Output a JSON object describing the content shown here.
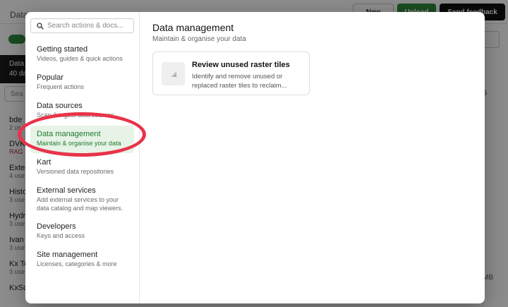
{
  "background": {
    "title": "Data",
    "new_button": "New",
    "upload_button": "Upload",
    "feedback_button": "Send feedback",
    "active_item": {
      "name": "Data",
      "count": "40 da"
    },
    "search": "Sea",
    "list": [
      {
        "name": "bde",
        "sub": "2 us"
      },
      {
        "name": "DVK",
        "sub": "RAG"
      },
      {
        "name": "Exter",
        "sub": "4 use"
      },
      {
        "name": "Histo",
        "sub": "3 use"
      },
      {
        "name": "Hydr",
        "sub": "3 use"
      },
      {
        "name": "Ivan",
        "sub": "3 use"
      },
      {
        "name": "Kx Te",
        "sub": "3 use"
      },
      {
        "name": "KxSc",
        "sub": ""
      }
    ],
    "right_1": "",
    "right_2": "5",
    "right_3": "MB"
  },
  "modal": {
    "search": {
      "placeholder": "Search actions & docs..."
    },
    "nav": [
      {
        "label": "Getting started",
        "sub": "Videos, guides & quick actions"
      },
      {
        "label": "Popular",
        "sub": "Frequent actions"
      },
      {
        "label": "Data sources",
        "sub": "Scan & ingest data sources"
      },
      {
        "label": "Data management",
        "sub": "Maintain & organise your data"
      },
      {
        "label": "Kart",
        "sub": "Versioned data repositories"
      },
      {
        "label": "External services",
        "sub": "Add external services to your data catalog and map viewers."
      },
      {
        "label": "Developers",
        "sub": "Keys and access"
      },
      {
        "label": "Site management",
        "sub": "Licenses, categories & more"
      }
    ],
    "active_index": 3,
    "section": {
      "title": "Data management",
      "description": "Maintain & organise your data"
    },
    "card": {
      "title": "Review unused raster tiles",
      "description": "Identify and remove unused or replaced raster tiles to reclaim..."
    }
  },
  "colors": {
    "accent": "#2e8b3e",
    "active_bg": "#e7f3e7",
    "annotation": "#e8334a"
  }
}
